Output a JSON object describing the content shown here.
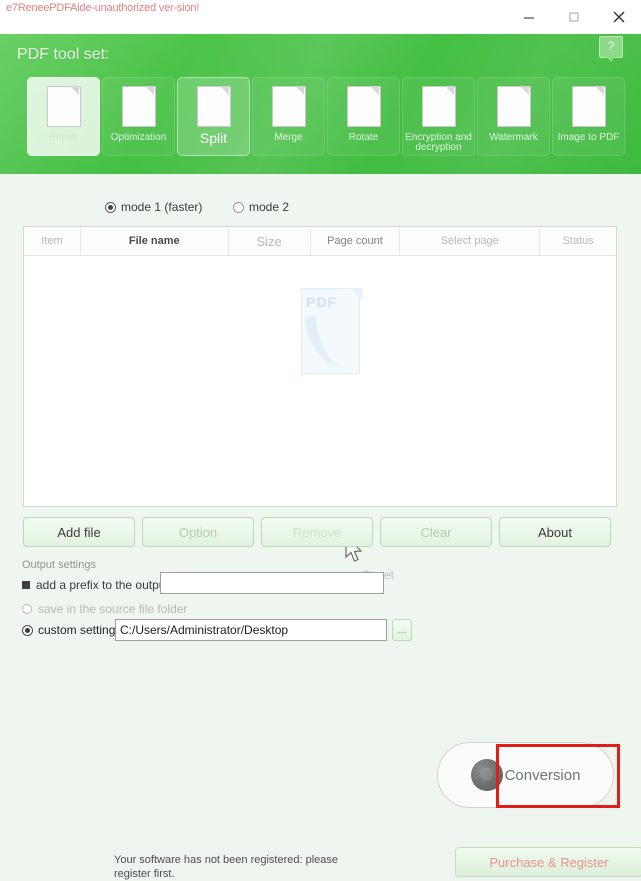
{
  "window": {
    "title": "e7ReneePDFAide-unauthorized ver-sion!",
    "minimize_label": "minimize",
    "maximize_label": "maximize",
    "close_label": "close"
  },
  "header": {
    "title": "PDF tool set:",
    "help_label": "?",
    "accent_color": "#45bf44",
    "tools": [
      {
        "label": "Repair",
        "icon": "repair-gear-icon",
        "state": "active"
      },
      {
        "label": "Optimization",
        "icon": "rocket-icon",
        "state": "normal"
      },
      {
        "label": "Split",
        "icon": "scissors-document-icon",
        "state": "selected"
      },
      {
        "label": "Merge",
        "icon": "puzzle-icon",
        "state": "normal"
      },
      {
        "label": "Rotate",
        "icon": "rotate-arrow-icon",
        "state": "normal"
      },
      {
        "label": "Encryption and decryption",
        "icon": "lock-folder-icon",
        "state": "normal"
      },
      {
        "label": "Watermark",
        "icon": "picture-frames-icon",
        "state": "normal"
      },
      {
        "label": "Image to PDF",
        "icon": "image-to-pdf-icon",
        "state": "normal"
      }
    ]
  },
  "modes": {
    "watermark_text": "",
    "options": [
      {
        "label": "mode 1 (faster)",
        "selected": true
      },
      {
        "label": "mode 2",
        "selected": false
      }
    ]
  },
  "file_list": {
    "columns": [
      "Item",
      "File name",
      "Size",
      "Page count",
      "Select page",
      "Status"
    ],
    "rows": [],
    "empty_icon_label": "PDF",
    "empty_watermark": "Street"
  },
  "actions": [
    {
      "label": "Add file",
      "enabled": true
    },
    {
      "label": "Option",
      "enabled": false
    },
    {
      "label": "Remove",
      "enabled": false
    },
    {
      "label": "Clear",
      "enabled": false
    },
    {
      "label": "About",
      "enabled": true
    }
  ],
  "output_settings": {
    "section_label": "Output settings",
    "prefix_label": "add a prefix to the output file to fix",
    "prefix_value": "",
    "prefix_placeholder": "",
    "source_folder_label": "save in the source file folder",
    "custom_label": "custom settings",
    "custom_path": "C:/Users/Administrator/Desktop",
    "browse_label": "..."
  },
  "conversion": {
    "label": "Conversion",
    "icon": "conversion-icon",
    "highlight_color": "#e21b1b"
  },
  "footer": {
    "registration_note": "Your software has not been registered: please register first.",
    "purchase_label": "Purchase & Register"
  }
}
